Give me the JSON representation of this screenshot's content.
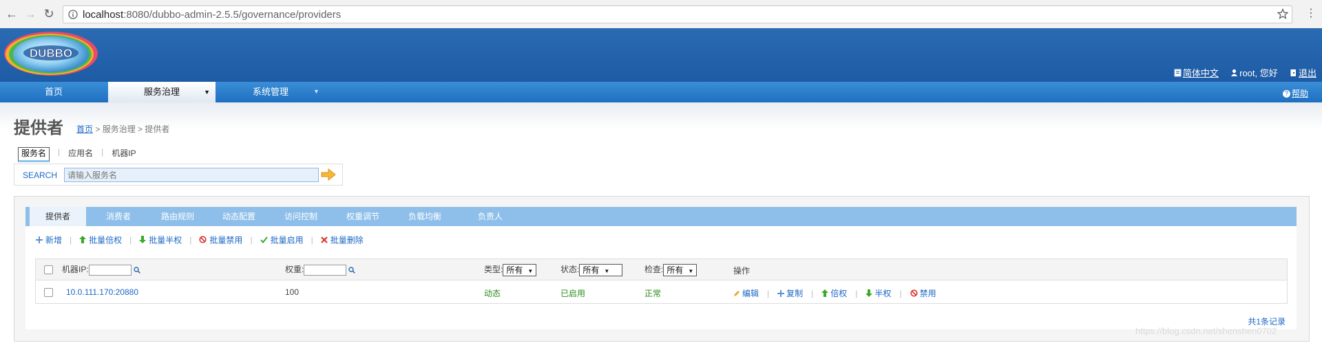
{
  "browser": {
    "url_host": "localhost",
    "url_path": ":8080/dubbo-admin-2.5.5/governance/providers"
  },
  "header": {
    "logo_text": "DUBBO",
    "language_link": "简体中文",
    "user_greeting": "root, 您好",
    "logout_link": "退出"
  },
  "main_nav": {
    "tabs": [
      {
        "label": "首页"
      },
      {
        "label": "服务治理"
      },
      {
        "label": "系统管理"
      }
    ],
    "help": "帮助"
  },
  "page": {
    "title": "提供者",
    "breadcrumb": {
      "home": "首页",
      "rest": " > 服务治理 > 提供者"
    }
  },
  "search": {
    "tabs": [
      "服务名",
      "应用名",
      "机器IP"
    ],
    "label": "SEARCH",
    "placeholder": "请输入服务名"
  },
  "panel_tabs": [
    "提供者",
    "消费者",
    "路由规则",
    "动态配置",
    "访问控制",
    "权重调节",
    "负载均衡",
    "负责人"
  ],
  "toolbar": {
    "add": "新增",
    "batch_double": "批量倍权",
    "batch_half": "批量半权",
    "batch_disable": "批量禁用",
    "batch_enable": "批量启用",
    "batch_delete": "批量删除"
  },
  "table": {
    "headers": {
      "ip": "机器IP:",
      "weight": "权重:",
      "type": "类型:",
      "status": "状态:",
      "check": "检查:",
      "ops": "操作"
    },
    "filters": {
      "type": "所有",
      "status": "所有",
      "check": "所有"
    },
    "rows": [
      {
        "address": "10.0.111.170:20880",
        "weight": "100",
        "type": "动态",
        "status": "已启用",
        "check": "正常",
        "ops": [
          "编辑",
          "复制",
          "倍权",
          "半权",
          "禁用"
        ]
      }
    ],
    "total": "共1条记录"
  },
  "watermark": "https://blog.csdn.net/shenshen0702",
  "colors": {
    "header_blue": "#1e5ba5",
    "nav_blue": "#1f6fc1",
    "panel_tab_blue": "#8ebfea",
    "link_blue": "#1a67c6",
    "ok_green": "#2e8b1d"
  }
}
